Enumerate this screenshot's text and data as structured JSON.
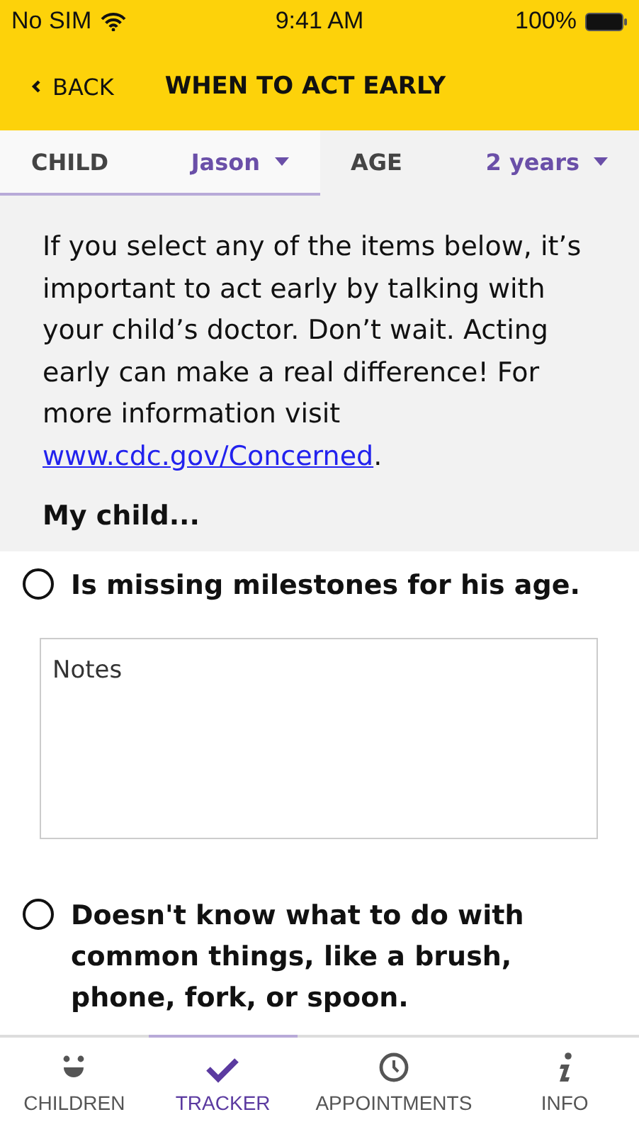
{
  "status_bar": {
    "carrier": "No SIM",
    "time": "9:41 AM",
    "battery": "100%"
  },
  "nav": {
    "back": "BACK",
    "title": "WHEN TO ACT EARLY"
  },
  "filters": [
    {
      "label": "CHILD",
      "value": "Jason",
      "selected": true
    },
    {
      "label": "AGE",
      "value": "2 years",
      "selected": false
    }
  ],
  "intro": {
    "text": "If you select any of the items below, it’s important to act early by talking with your child’s doctor. Don’t wait. Acting early can make a real difference! For more information visit ",
    "link": "www.cdc.gov/Concerned",
    "end": "."
  },
  "section_heading": "My child...",
  "items": [
    {
      "text": "Is missing milestones for his age.",
      "checked": false,
      "notes_placeholder": "Notes"
    },
    {
      "text": "Doesn't know what to do with common things, like a brush, phone, fork, or spoon.",
      "checked": false
    }
  ],
  "tab_bar": [
    {
      "label": "CHILDREN",
      "kind": "face",
      "selected": false
    },
    {
      "label": "TRACKER",
      "kind": "check",
      "selected": true
    },
    {
      "label": "APPOINTMENTS",
      "kind": "clock",
      "selected": false
    },
    {
      "label": "INFO",
      "kind": "info",
      "selected": false
    }
  ]
}
